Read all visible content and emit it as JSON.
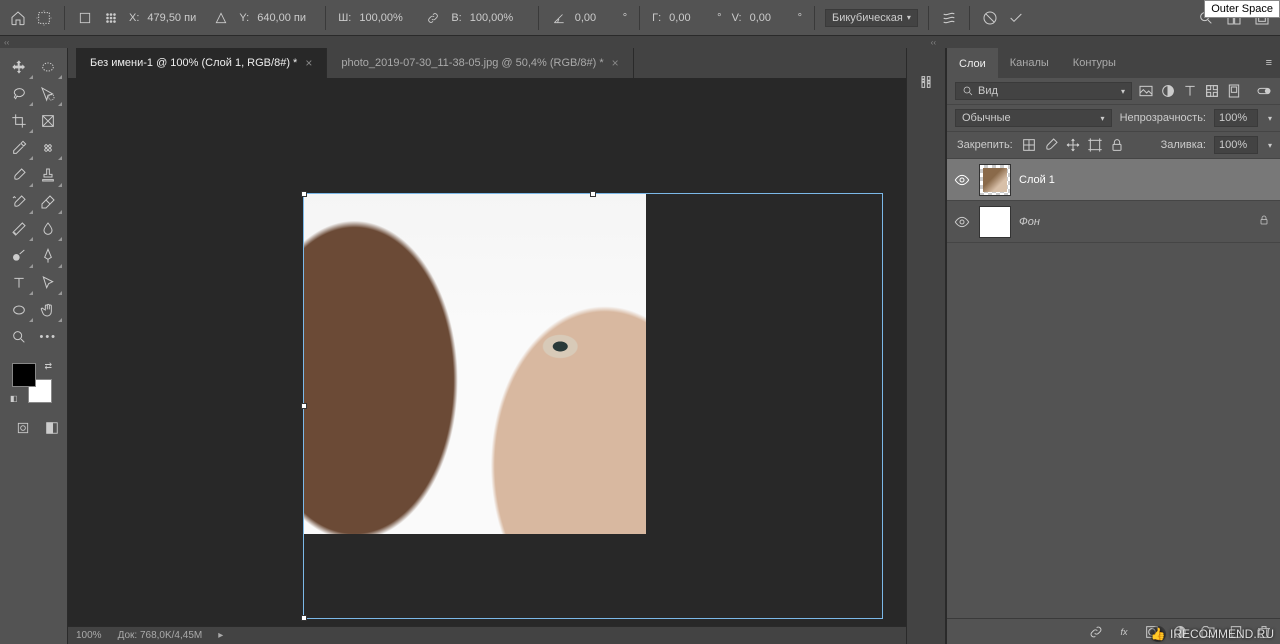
{
  "outer_tag": "Outer Space",
  "options_bar": {
    "x_label": "X:",
    "x_value": "479,50 пи",
    "y_label": "Y:",
    "y_value": "640,00 пи",
    "w_label": "Ш:",
    "w_value": "100,00%",
    "h_label": "В:",
    "h_value": "100,00%",
    "angle_value": "0,00",
    "h_skew_label": "Г:",
    "h_skew_value": "0,00",
    "v_skew_label": "V:",
    "v_skew_value": "0,00",
    "interp": "Бикубическая"
  },
  "tabs": [
    {
      "label": "Без имени-1 @ 100% (Слой 1, RGB/8#) *",
      "active": true
    },
    {
      "label": "photo_2019-07-30_11-38-05.jpg @ 50,4% (RGB/8#) *",
      "active": false
    }
  ],
  "status": {
    "zoom": "100%",
    "doc": "Док: 768,0K/4,45M"
  },
  "layers_panel": {
    "tabs": {
      "layers": "Слои",
      "channels": "Каналы",
      "paths": "Контуры"
    },
    "filter_label": "Вид",
    "blend_mode": "Обычные",
    "opacity_label": "Непрозрачность:",
    "opacity_value": "100%",
    "lock_label": "Закрепить:",
    "fill_label": "Заливка:",
    "fill_value": "100%",
    "layers": [
      {
        "name": "Слой 1",
        "selected": true,
        "locked": false,
        "italic": false,
        "thumb": "photo"
      },
      {
        "name": "Фон",
        "selected": false,
        "locked": true,
        "italic": true,
        "thumb": "white"
      }
    ]
  },
  "watermark": "IRECOMMEND.RU"
}
